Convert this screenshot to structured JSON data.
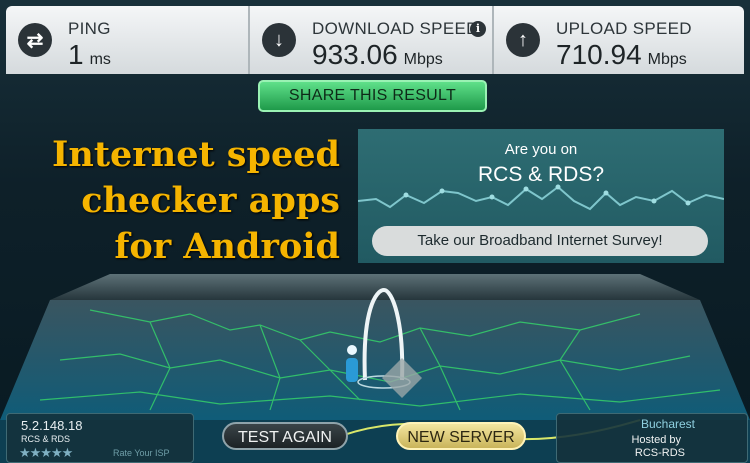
{
  "stats": {
    "ping": {
      "label": "PING",
      "value": "1",
      "unit": "ms",
      "icon": "ping-exchange-icon"
    },
    "download": {
      "label": "DOWNLOAD SPEED",
      "value": "933.06",
      "unit": "Mbps",
      "icon": "download-arrow-icon"
    },
    "upload": {
      "label": "UPLOAD SPEED",
      "value": "710.94",
      "unit": "Mbps",
      "icon": "upload-arrow-icon"
    }
  },
  "share_label": "SHARE THIS RESULT",
  "headline": {
    "line1": "Internet speed",
    "line2": "checker apps",
    "line3": "for Android"
  },
  "ad": {
    "question": "Are you on",
    "isp": "RCS & RDS?",
    "cta": "Take our Broadband Internet Survey!"
  },
  "isp_panel": {
    "ip": "5.2.148.18",
    "isp": "RCS & RDS",
    "stars": "★★★★★",
    "rate_label": "Rate Your ISP"
  },
  "buttons": {
    "test_again": "TEST AGAIN",
    "new_server": "NEW SERVER"
  },
  "server_panel": {
    "city": "Bucharest",
    "hosted_label": "Hosted by",
    "host": "RCS-RDS"
  },
  "colors": {
    "accent_green": "#2fbf60",
    "headline_yellow": "#f5b400",
    "button_gold": "#d8c46a"
  }
}
